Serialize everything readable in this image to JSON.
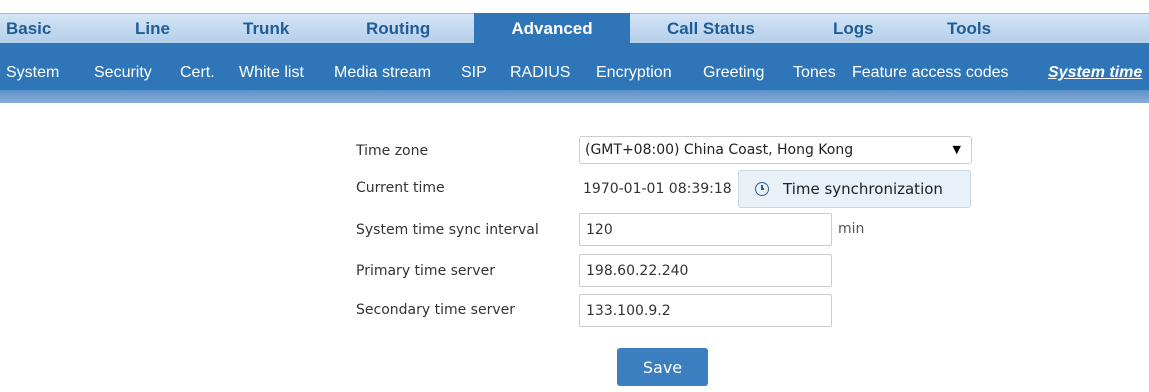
{
  "main_tabs": [
    {
      "label": "Basic"
    },
    {
      "label": "Line"
    },
    {
      "label": "Trunk"
    },
    {
      "label": "Routing"
    },
    {
      "label": "Advanced",
      "active": true
    },
    {
      "label": "Call Status"
    },
    {
      "label": "Logs"
    },
    {
      "label": "Tools"
    }
  ],
  "sub_tabs": [
    {
      "label": "System"
    },
    {
      "label": "Security"
    },
    {
      "label": "Cert."
    },
    {
      "label": "White list"
    },
    {
      "label": "Media stream"
    },
    {
      "label": "SIP"
    },
    {
      "label": "RADIUS"
    },
    {
      "label": "Encryption"
    },
    {
      "label": "Greeting"
    },
    {
      "label": "Tones"
    },
    {
      "label": "Feature access codes"
    },
    {
      "label": "System time",
      "active": true
    }
  ],
  "form": {
    "time_zone": {
      "label": "Time zone",
      "value": "(GMT+08:00) China Coast, Hong Kong"
    },
    "current_time": {
      "label": "Current time",
      "value": "1970-01-01 08:39:18"
    },
    "sync_button": {
      "label": "Time synchronization",
      "icon": "clock-icon"
    },
    "sync_interval": {
      "label": "System time sync interval",
      "value": "120",
      "unit": "min"
    },
    "primary_server": {
      "label": "Primary time server",
      "value": "198.60.22.240"
    },
    "secondary_server": {
      "label": "Secondary time server",
      "value": "133.100.9.2"
    },
    "save_label": "Save"
  },
  "colors": {
    "accent": "#2f76b9",
    "nav_text": "#1f5d99",
    "save_button": "#3c7fc0"
  }
}
